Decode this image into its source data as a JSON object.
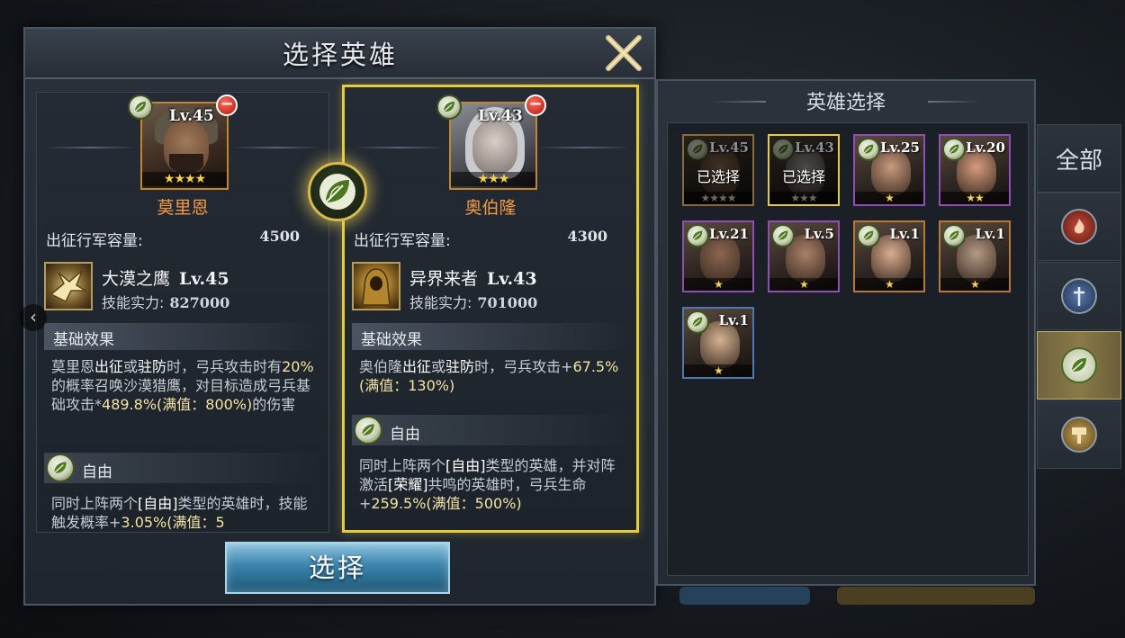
{
  "dialog": {
    "title": "选择英雄",
    "select_button": "选择"
  },
  "left_hero": {
    "level": "Lv.45",
    "stars": "★★★★",
    "name": "莫里恩",
    "capacity_label": "出征行军容量:",
    "capacity_value": "4500",
    "skill_name": "大漠之鹰",
    "skill_level": "Lv.45",
    "skill_power_label": "技能实力:",
    "skill_power_value": "827000",
    "base_effect_title": "基础效果",
    "base_effect_parts": [
      "莫里恩",
      "出征",
      "或",
      "驻防",
      "时，弓兵攻击时有",
      "20%",
      "的概率召唤沙漠猎鹰，对目标造成弓兵基础攻击*",
      "489.8%(满值：800%)",
      "的伤害"
    ],
    "bond_title": "自由",
    "bond_parts": [
      "同时上阵两个",
      "[自由]",
      "类型的英雄时，技能触发概率+",
      "3.05%(满值：5"
    ]
  },
  "right_hero": {
    "level": "Lv.43",
    "stars": "★★★",
    "name": "奥伯隆",
    "capacity_label": "出征行军容量:",
    "capacity_value": "4300",
    "skill_name": "异界来者",
    "skill_level": "Lv.43",
    "skill_power_label": "技能实力:",
    "skill_power_value": "701000",
    "base_effect_title": "基础效果",
    "base_effect_parts": [
      "奥伯隆",
      "出征",
      "或",
      "驻防",
      "时，弓兵攻击+",
      "67.5%(满值：130%)"
    ],
    "bond_title": "自由",
    "bond_parts": [
      "同时上阵两个",
      "[自由]",
      "类型的英雄，并对阵激活",
      "[荣耀]",
      "共鸣的英雄时，弓兵生命+",
      "259.5%(满值：500%)"
    ]
  },
  "hero_select": {
    "title": "英雄选择",
    "selected_text": "已选择",
    "heroes": [
      {
        "level": "Lv.45",
        "stars": "★★★★",
        "selected": true,
        "frame": "#8a6a3a",
        "skin": "#8a6d55"
      },
      {
        "level": "Lv.43",
        "stars": "★★★",
        "selected": true,
        "frame": "#e4cc3a",
        "skin": "#a7a4a2"
      },
      {
        "level": "Lv.25",
        "stars": "★",
        "selected": false,
        "frame": "#8e4fb5",
        "skin": "#c99a7e"
      },
      {
        "level": "Lv.20",
        "stars": "★★",
        "selected": false,
        "frame": "#8e4fb5",
        "skin": "#d69c7e"
      },
      {
        "level": "Lv.21",
        "stars": "★",
        "selected": false,
        "frame": "#8e4fb5",
        "skin": "#8a6650"
      },
      {
        "level": "Lv.5",
        "stars": "★",
        "selected": false,
        "frame": "#8e4fb5",
        "skin": "#a98068"
      },
      {
        "level": "Lv.1",
        "stars": "★",
        "selected": false,
        "frame": "#b4793a",
        "skin": "#d8ad90"
      },
      {
        "level": "Lv.1",
        "stars": "★",
        "selected": false,
        "frame": "#b4793a",
        "skin": "#b59985"
      },
      {
        "level": "Lv.1",
        "stars": "★",
        "selected": false,
        "frame": "#4d77b0",
        "skin": "#d4b291"
      }
    ]
  },
  "tabs": {
    "all_label": "全部",
    "items": [
      "fire-tab-icon",
      "sword-tab-icon",
      "leaf-tab-icon",
      "hammer-tab-icon"
    ]
  },
  "colors": {
    "accent_gold": "#e4cc3a",
    "name_orange": "#f39a43",
    "button_blue": "#3b84ad"
  }
}
